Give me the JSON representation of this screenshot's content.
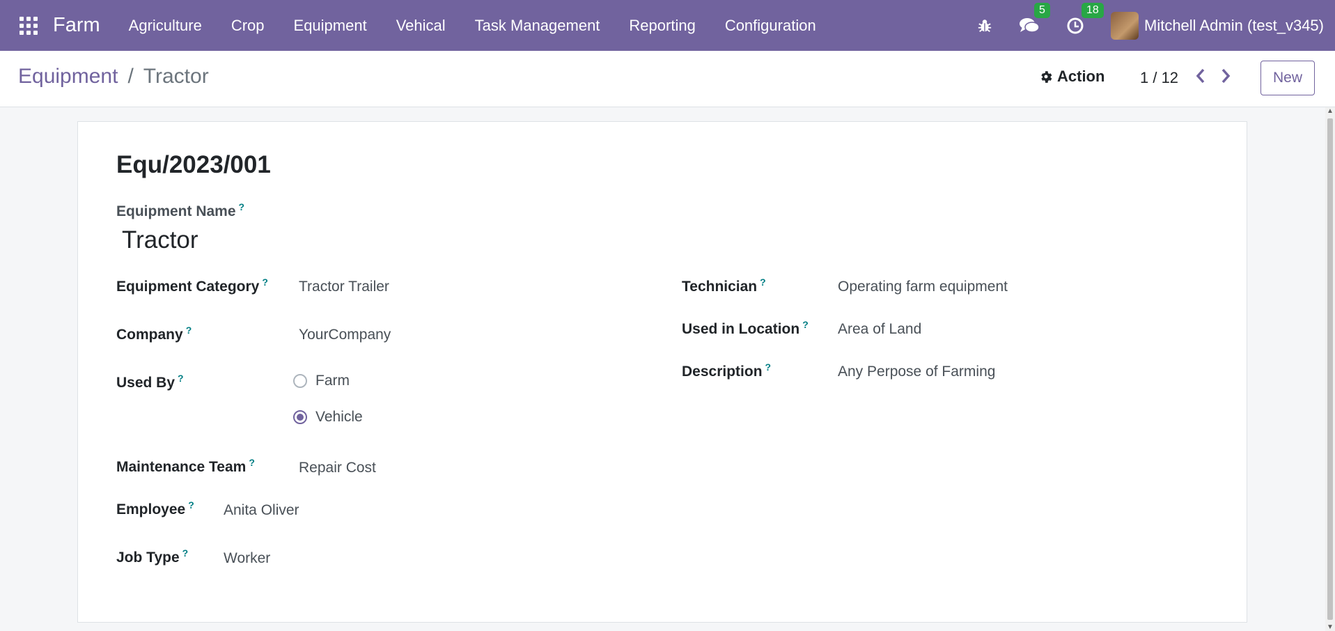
{
  "navbar": {
    "brand": "Farm",
    "menu": [
      "Agriculture",
      "Crop",
      "Equipment",
      "Vehical",
      "Task Management",
      "Reporting",
      "Configuration"
    ],
    "messages_count": "5",
    "activities_count": "18",
    "user_name": "Mitchell Admin (test_v345)",
    "accent": "#71639e",
    "badge_color": "#28a745"
  },
  "control": {
    "breadcrumb_parent": "Equipment",
    "breadcrumb_separator": "/",
    "breadcrumb_current": "Tractor",
    "action_label": "Action",
    "pager": "1 / 12",
    "new_label": "New"
  },
  "form": {
    "reference": "Equ/2023/001",
    "equipment_name_label": "Equipment Name",
    "equipment_name": "Tractor",
    "help_mark": "?",
    "left": {
      "category_label": "Equipment Category",
      "category": "Tractor Trailer",
      "company_label": "Company",
      "company": "YourCompany",
      "used_by_label": "Used By",
      "used_by_options": [
        "Farm",
        "Vehicle"
      ],
      "used_by_selected": "Vehicle",
      "maintenance_team_label": "Maintenance Team",
      "maintenance_team": "Repair Cost",
      "employee_label": "Employee",
      "employee": "Anita Oliver",
      "job_type_label": "Job Type",
      "job_type": "Worker"
    },
    "right": {
      "technician_label": "Technician",
      "technician": "Operating farm equipment",
      "location_label": "Used in Location",
      "location": "Area of Land",
      "description_label": "Description",
      "description": "Any Perpose of Farming"
    }
  }
}
